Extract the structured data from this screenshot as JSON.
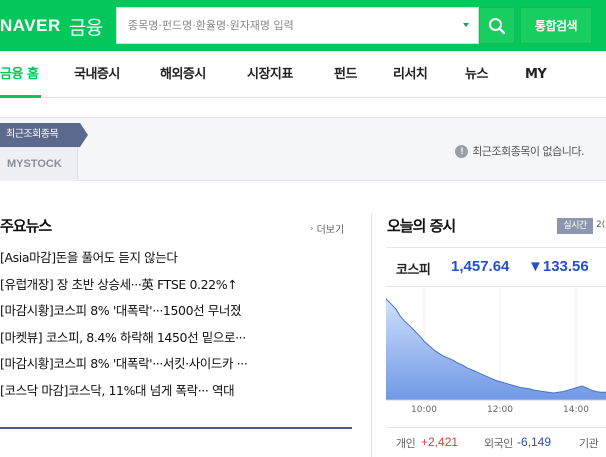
{
  "header": {
    "logo_naver": "NAVER",
    "logo_finance": "금융",
    "search_placeholder": "종목명·펀드명·환율명·원자재명 입력",
    "total_search_label": "통합검색",
    "brand_color": "#03c75a"
  },
  "nav": {
    "items": [
      {
        "label": "금융 홈",
        "active": true
      },
      {
        "label": "국내증시"
      },
      {
        "label": "해외증시"
      },
      {
        "label": "시장지표"
      },
      {
        "label": "펀드"
      },
      {
        "label": "리서치"
      },
      {
        "label": "뉴스"
      },
      {
        "label": "MY"
      }
    ]
  },
  "recent": {
    "tab_label": "최근조회종목",
    "mystock_label": "MYSTOCK",
    "empty_message": "최근조회종목이 없습니다."
  },
  "news": {
    "title": "주요뉴스",
    "more_label": "더보기",
    "items": [
      "[Asia마감]돈을 풀어도 듣지 않는다",
      "[유럽개장] 장 초반 상승세···英 FTSE 0.22%↑",
      "[마감시황]코스피 8% '대폭락'···1500선 무너졌",
      "[마켓뷰] 코스피, 8.4% 하락해 1450선 밑으로···",
      "[마감시황]코스피 8% '대폭락'···서킷·사이드카 ···",
      "[코스닥 마감]코스닥, 11%대 넘게 폭락··· 역대"
    ]
  },
  "market": {
    "title": "오늘의 증시",
    "realtime_label": "실시간",
    "realtime_suffix": "2(",
    "index_name": "코스피",
    "index_value": "1,457.64",
    "index_change": "▼133.56",
    "flow": {
      "individual_label": "개인",
      "individual_value": "+2,421",
      "foreign_label": "외국인",
      "foreign_value": "-6,149",
      "institution_label": "기관"
    },
    "up_color": "#e03a3a",
    "down_color": "#2451c9"
  },
  "chart_data": {
    "type": "area",
    "x_ticks": [
      "10:00",
      "12:00",
      "14:00"
    ],
    "series": [
      {
        "values": [
          1591,
          1584,
          1577,
          1566,
          1558,
          1552,
          1545,
          1538,
          1530,
          1524,
          1518,
          1513,
          1509,
          1506,
          1503,
          1499,
          1496,
          1492,
          1489,
          1486,
          1483,
          1480,
          1477,
          1474,
          1472,
          1470,
          1468,
          1466,
          1464,
          1463,
          1462,
          1460,
          1459,
          1458,
          1457,
          1456,
          1457,
          1458,
          1460,
          1462,
          1464,
          1466,
          1463,
          1460,
          1458,
          1457,
          1457
        ]
      }
    ]
  }
}
